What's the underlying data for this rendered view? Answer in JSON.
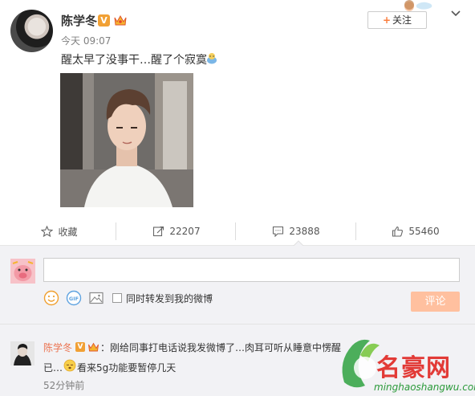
{
  "post": {
    "author": "陈学冬",
    "verified_badge": "V",
    "follow_label": "关注",
    "follow_plus": "+",
    "time": "今天 09:07",
    "text": "醒太早了没事干…醒了个寂寞"
  },
  "actions": {
    "favorite": "收藏",
    "repost": "22207",
    "comment": "23888",
    "like": "55460"
  },
  "composer": {
    "repost_checkbox_label": "同时转发到我的微博",
    "submit_label": "评论",
    "input_value": ""
  },
  "comment": {
    "author": "陈学冬",
    "verified_badge": "V",
    "separator": "：",
    "text_line1": "刚给同事打电话说我发微博了…肉耳可听从睡意中愣醒",
    "text_line2a": "已…",
    "text_line2b": "看来5g功能要暂停几天",
    "time": "52分钟前"
  },
  "watermark": {
    "title": "名豪网",
    "url": "minghaoshangwu.com"
  },
  "colors": {
    "orange_accent": "#fa7d3c",
    "comment_name": "#eb7350",
    "submit_bg": "#ffc09f",
    "watermark_red": "#e23a36",
    "watermark_green": "#2b9a3a"
  }
}
